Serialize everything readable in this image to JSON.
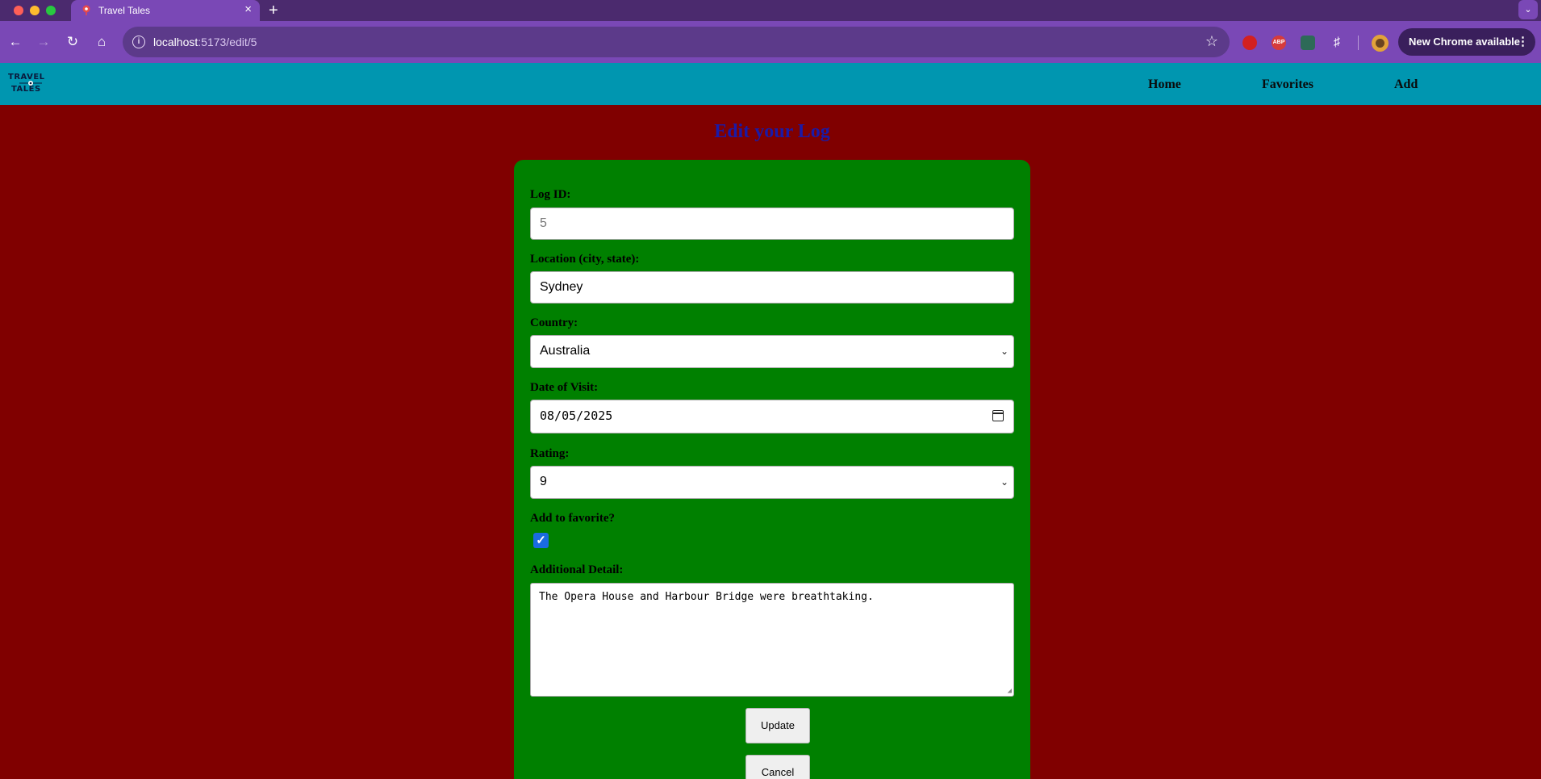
{
  "browser": {
    "tab_title": "Travel Tales",
    "tab_close": "×",
    "new_tab": "+",
    "url_host": "localhost",
    "url_rest": ":5173/edit/5",
    "update_button": "New Chrome available",
    "more_icon": "⋮",
    "ext_abp": "ABP"
  },
  "site": {
    "logo_top": "TRAVEL",
    "logo_bottom": "TALES",
    "nav": {
      "home": "Home",
      "favorites": "Favorites",
      "add": "Add"
    }
  },
  "page": {
    "title": "Edit your Log"
  },
  "form": {
    "log_id_label": "Log ID:",
    "log_id_value": "5",
    "location_label": "Location (city, state):",
    "location_value": "Sydney",
    "country_label": "Country:",
    "country_value": "Australia",
    "date_label": "Date of Visit:",
    "date_value": "08/05/2025",
    "rating_label": "Rating:",
    "rating_value": "9",
    "favorite_label": "Add to favorite?",
    "favorite_checked": true,
    "detail_label": "Additional Detail:",
    "detail_value": "The Opera House and Harbour Bridge were breathtaking.",
    "update_button": "Update",
    "cancel_button": "Cancel"
  },
  "colors": {
    "page_background": "#800000",
    "header_background": "#0096b0",
    "card_background": "#008000",
    "title_color": "#1a1aa8",
    "browser_chrome": "#7a48b6"
  }
}
